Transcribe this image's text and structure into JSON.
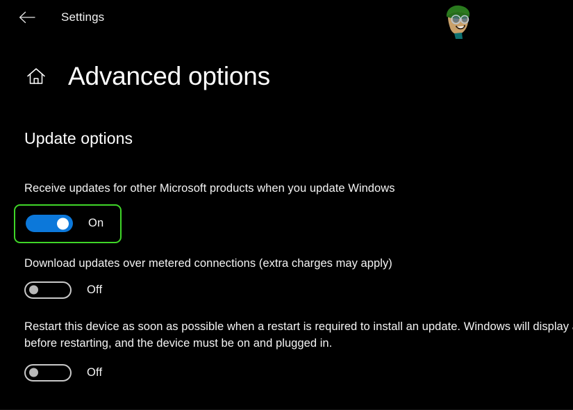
{
  "window": {
    "app_title": "Settings",
    "back_icon": "arrow-left-icon",
    "watermark_icon": "appuals-mascot-logo"
  },
  "page": {
    "home_icon": "home-icon",
    "title": "Advanced options"
  },
  "section": {
    "title": "Update options"
  },
  "settings": [
    {
      "label": "Receive updates for other Microsoft products when you update Windows",
      "state": "On",
      "toggle_on": true,
      "highlighted": true
    },
    {
      "label": "Download updates over metered connections (extra charges may apply)",
      "state": "Off",
      "toggle_on": false,
      "highlighted": false
    },
    {
      "label": "Restart this device as soon as possible when a restart is required to install an update. Windows will display a notice before restarting, and the device must be on and plugged in.",
      "state": "Off",
      "toggle_on": false,
      "highlighted": false
    }
  ],
  "colors": {
    "background": "#000000",
    "text": "#ffffff",
    "toggle_on": "#0c78da",
    "toggle_off_border": "#c9c9c9",
    "toggle_off_knob": "#b9b9b9",
    "highlight_border": "#3fd628"
  }
}
